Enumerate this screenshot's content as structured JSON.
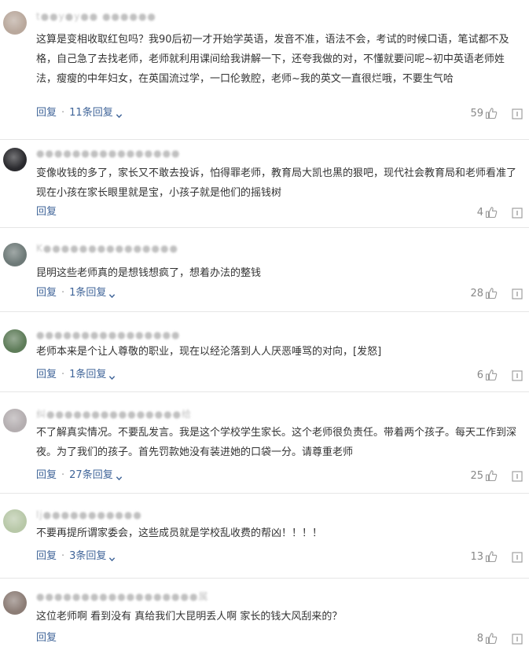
{
  "comments": [
    {
      "username": "t●●y●y●● ●●●●●●",
      "avatar_color": "#b9a89c",
      "text": "这算是变相收取红包吗？我90后初一才开始学英语，发音不准，语法不会，考试的时候口语，笔试都不及格，自己急了去找老师，老师就利用课间给我讲解一下，还夸我做的对，不懂就要问呢~初中英语老师姓法，瘦瘦的中年妇女，在英国流过学，一口伦敦腔，老师~我的英文一直很烂哦，不要生气哈",
      "reply": "回复",
      "reply_count": "11条回复",
      "likes": "59"
    },
    {
      "username": "●●●●●●●●●●●●●●●●",
      "avatar_color": "#2a2a2e",
      "text": "变像收钱的多了，家长又不敢去投诉，怕得罪老师，教育局大凯也黑的狠吧，现代社会教育局和老师看准了现在小孩在家长眼里就是宝，小孩子就是他们的摇钱树",
      "reply": "回复",
      "reply_count": "",
      "likes": "4"
    },
    {
      "username": "K●●●●●●●●●●●●●●●",
      "avatar_color": "#6e7a78",
      "text": "昆明这些老师真的是想钱想疯了，想着办法的整钱",
      "reply": "回复",
      "reply_count": "1条回复",
      "likes": "28"
    },
    {
      "username": "●●●●●●●●●●●●●●●●",
      "avatar_color": "#5f7d5a",
      "text": "老师本来是个让人尊敬的职业，现在以经沦落到人人厌恶唾骂的对向，[发怒]",
      "reply": "回复",
      "reply_count": "1条回复",
      "likes": "6"
    },
    {
      "username": "纠●●●●●●●●●●●●●●●给",
      "avatar_color": "#b4aeb0",
      "text": "不了解真实情况。不要乱发言。我是这个学校学生家长。这个老师很负责任。带着两个孩子。每天工作到深夜。为了我们的孩子。首先罚款她没有装进她的口袋一分。请尊重老师",
      "reply": "回复",
      "reply_count": "27条回复",
      "likes": "25"
    },
    {
      "username": "lj●●●●●●●●●●●",
      "avatar_color": "#b8c8a8",
      "text": "不要再提所谓家委会，这些成员就是学校乱收费的帮凶！！！！",
      "reply": "回复",
      "reply_count": "3条回复",
      "likes": "13"
    },
    {
      "username": "●●●●●●●●●●●●●●●●●●属",
      "avatar_color": "#8c7d76",
      "text": "这位老师啊 看到没有 真给我们大昆明丢人啊 家长的钱大风刮来的？",
      "reply": "回复",
      "reply_count": "",
      "likes": "8"
    }
  ],
  "icons": {
    "like": "thumbs-up-icon",
    "report": "report-icon",
    "expand": "chevron-down-icon"
  },
  "colors": {
    "link": "#406599",
    "text": "#333333",
    "muted": "#888888",
    "divider": "#e6e6e6"
  }
}
